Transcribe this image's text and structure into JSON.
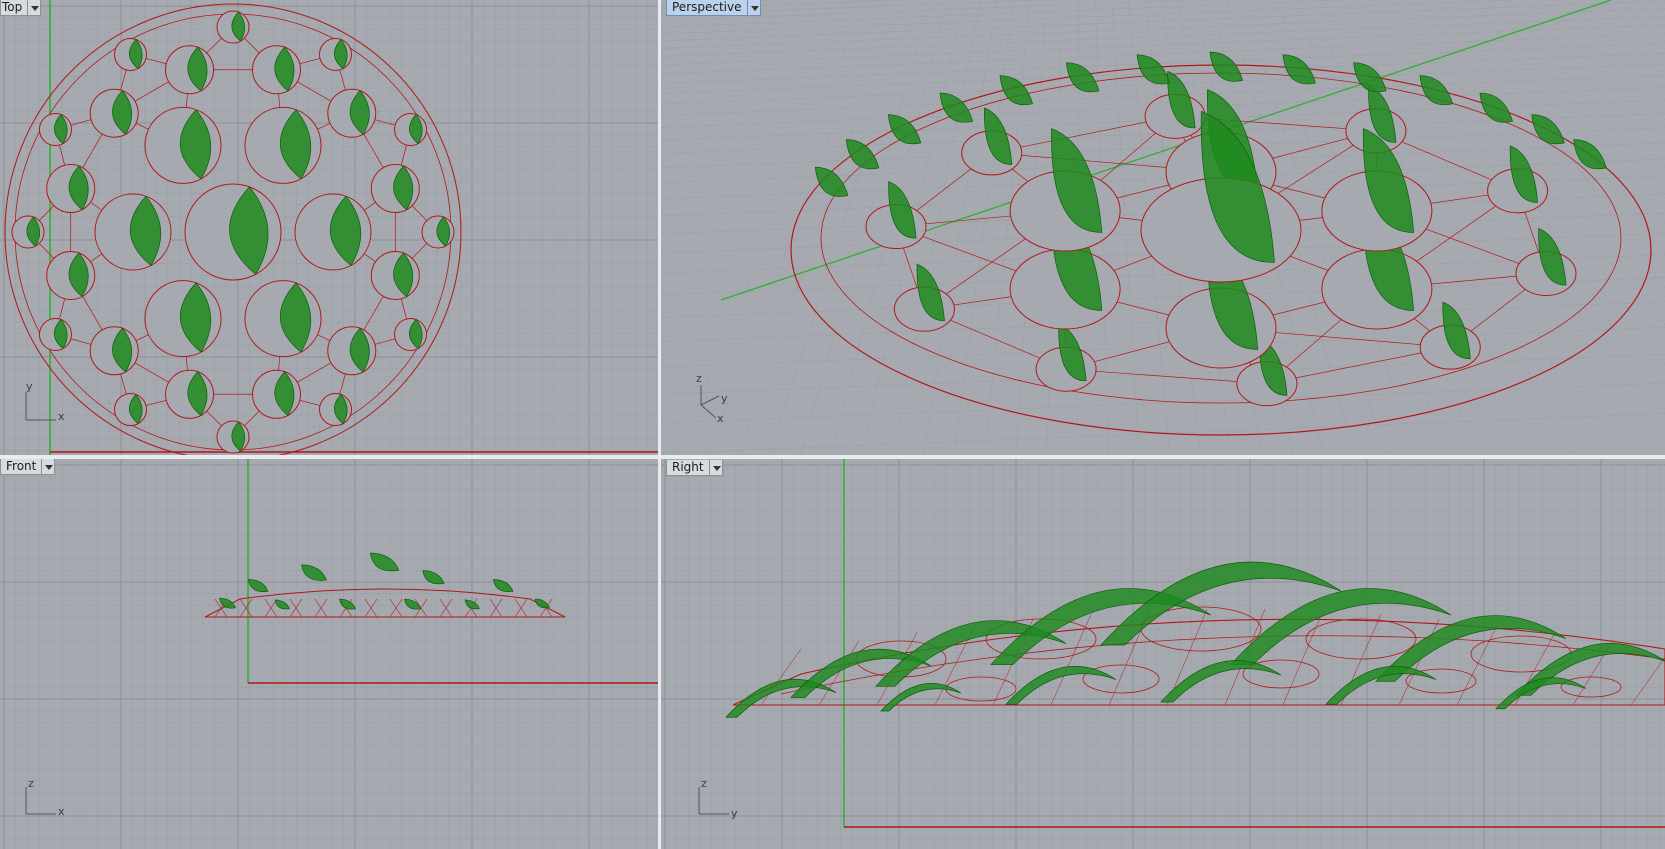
{
  "viewports": {
    "top": {
      "label": "Top",
      "axes": {
        "a": "y",
        "b": "x"
      }
    },
    "perspective": {
      "label": "Perspective",
      "axes": {
        "a": "z",
        "b": "y",
        "c": "x"
      }
    },
    "front": {
      "label": "Front",
      "axes": {
        "a": "z",
        "b": "x"
      }
    },
    "right": {
      "label": "Right",
      "axes": {
        "a": "z",
        "b": "y"
      }
    }
  },
  "colors": {
    "viewport_bg": "#a6aab0",
    "grid_minor": "#99a0a6",
    "grid_major": "#8a9096",
    "wireframe": "#b01818",
    "fins": "#1e8a1e",
    "world_axis": "#2fb02f",
    "active_tab": "#bcd2ea"
  }
}
